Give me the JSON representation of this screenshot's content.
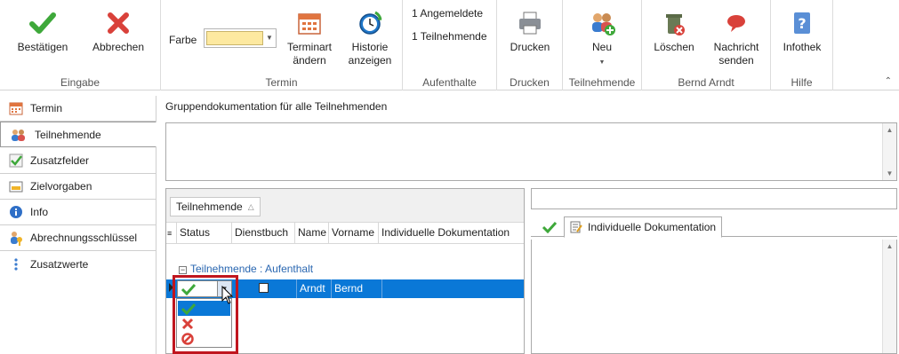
{
  "ribbon": {
    "groups": [
      {
        "label": "Eingabe"
      },
      {
        "label": "Termin"
      },
      {
        "label": "Aufenthalte"
      },
      {
        "label": "Drucken"
      },
      {
        "label": "Teilnehmende"
      },
      {
        "label": "Bernd Arndt"
      },
      {
        "label": "Hilfe"
      }
    ],
    "confirm_label": "Bestätigen",
    "cancel_label": "Abbrechen",
    "color_label": "Farbe",
    "color_value": "#fde9a0",
    "terminart_label_1": "Terminart",
    "terminart_label_2": "ändern",
    "historie_label_1": "Historie",
    "historie_label_2": "anzeigen",
    "angemeldete": "1 Angemeldete",
    "teilnehmende_count": "1 Teilnehmende",
    "print_label": "Drucken",
    "new_label": "Neu",
    "delete_label": "Löschen",
    "message_label_1": "Nachricht",
    "message_label_2": "senden",
    "infothek_label": "Infothek"
  },
  "nav": {
    "items": [
      {
        "label": "Termin",
        "icon": "calendar-icon"
      },
      {
        "label": "Teilnehmende",
        "icon": "people-icon"
      },
      {
        "label": "Zusatzfelder",
        "icon": "check-icon"
      },
      {
        "label": "Zielvorgaben",
        "icon": "target-icon"
      },
      {
        "label": "Info",
        "icon": "info-icon"
      },
      {
        "label": "Abrechnungsschlüssel",
        "icon": "key-user-icon"
      },
      {
        "label": "Zusatzwerte",
        "icon": "dots-icon"
      }
    ]
  },
  "main": {
    "group_doc_title": "Gruppendokumentation für alle Teilnehmenden"
  },
  "grid": {
    "group_chip": "Teilnehmende",
    "columns": [
      "Status",
      "Dienstbuch",
      "Name",
      "Vorname",
      "Individuelle Dokumentation"
    ],
    "group_row": "Teilnehmende : Aufenthalt",
    "row": {
      "name": "Arndt",
      "vorname": "Bernd"
    }
  },
  "right": {
    "tab_label": "Individuelle Dokumentation"
  }
}
